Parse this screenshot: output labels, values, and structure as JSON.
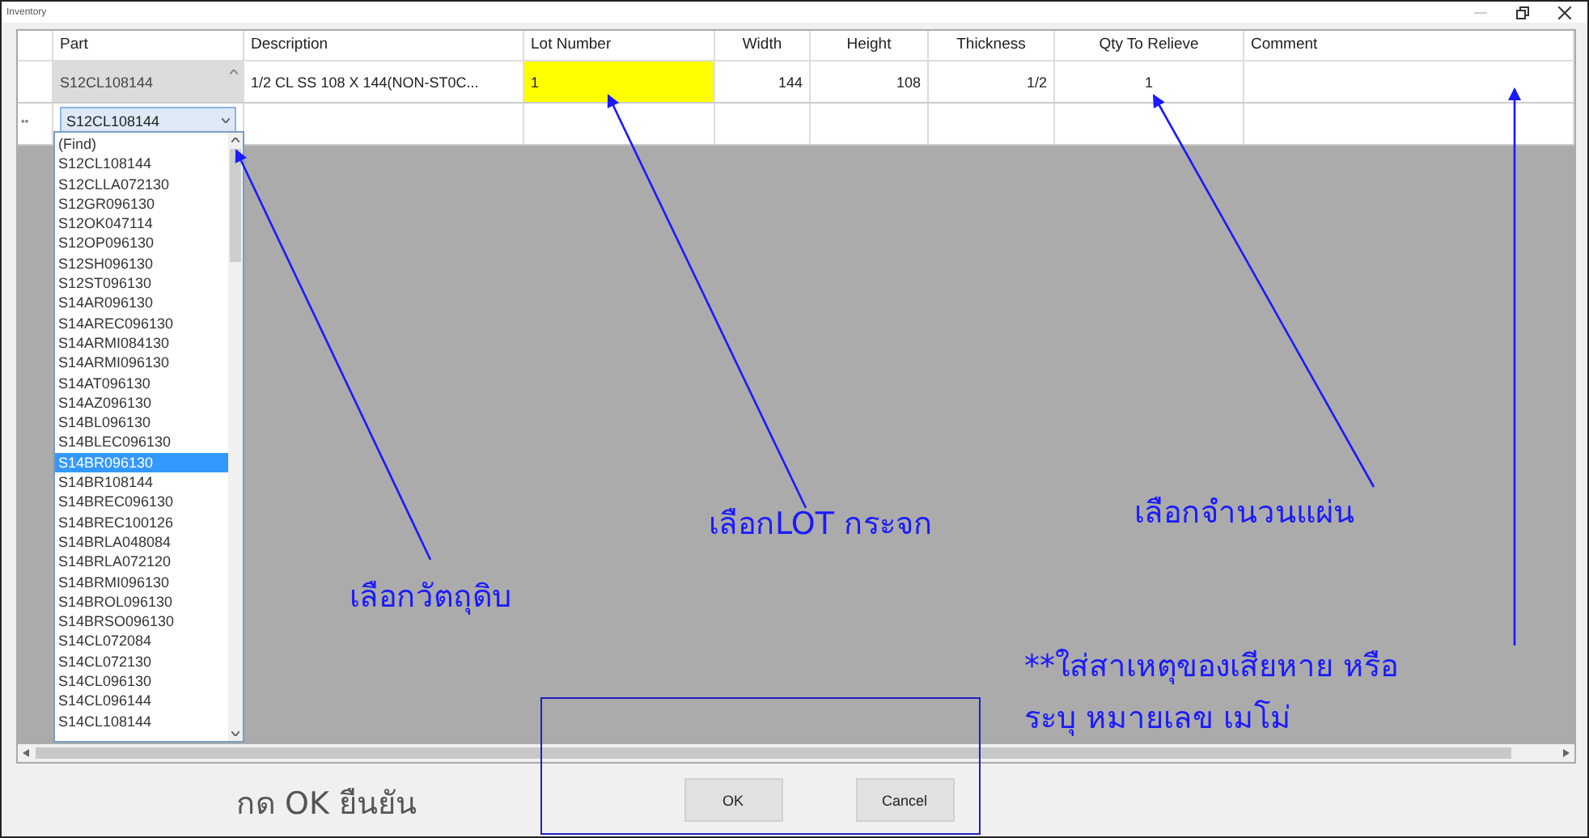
{
  "window": {
    "title": "Inventory"
  },
  "grid": {
    "columns": [
      "Part",
      "Description",
      "Lot Number",
      "Width",
      "Height",
      "Thickness",
      "Qty To Relieve",
      "Comment"
    ],
    "rows": [
      {
        "cells": [
          {
            "text": "S12CL108144",
            "highlighted": false
          },
          {
            "text": "1/2 CL SS 108 X 144(NON-ST0C...",
            "highlighted": false
          },
          {
            "text": "1",
            "highlighted": true
          },
          {
            "text": "144",
            "highlighted": false
          },
          {
            "text": "108",
            "highlighted": false
          },
          {
            "text": "1/2",
            "highlighted": false
          },
          {
            "text": "1",
            "highlighted": false
          }
        ]
      }
    ],
    "new_row": {
      "marker": "**",
      "part": "S12CL108144"
    }
  },
  "dropdown": {
    "items": [
      {
        "label": "(Find)",
        "selected": false
      },
      {
        "label": "S12CL108144",
        "selected": false
      },
      {
        "label": "S12CLLA072130",
        "selected": false
      },
      {
        "label": "S12GR096130",
        "selected": false
      },
      {
        "label": "S12OK047114",
        "selected": false
      },
      {
        "label": "S12OP096130",
        "selected": false
      },
      {
        "label": "S12SH096130",
        "selected": false
      },
      {
        "label": "S12ST096130",
        "selected": false
      },
      {
        "label": "S14AR096130",
        "selected": false
      },
      {
        "label": "S14AREC096130",
        "selected": false
      },
      {
        "label": "S14ARMI084130",
        "selected": false
      },
      {
        "label": "S14ARMI096130",
        "selected": false
      },
      {
        "label": "S14AT096130",
        "selected": false
      },
      {
        "label": "S14AZ096130",
        "selected": false
      },
      {
        "label": "S14BL096130",
        "selected": false
      },
      {
        "label": "S14BLEC096130",
        "selected": false
      },
      {
        "label": "S14BR096130",
        "selected": true
      },
      {
        "label": "S14BR108144",
        "selected": false
      },
      {
        "label": "S14BREC096130",
        "selected": false
      },
      {
        "label": "S14BREC100126",
        "selected": false
      },
      {
        "label": "S14BRLA048084",
        "selected": false
      },
      {
        "label": "S14BRLA072120",
        "selected": false
      },
      {
        "label": "S14BRMI096130",
        "selected": false
      },
      {
        "label": "S14BROL096130",
        "selected": false
      },
      {
        "label": "S14BRSO096130",
        "selected": false
      },
      {
        "label": "S14CL072084",
        "selected": false
      },
      {
        "label": "S14CL072130",
        "selected": false
      },
      {
        "label": "S14CL096130",
        "selected": false
      },
      {
        "label": "S14CL096144",
        "selected": false
      },
      {
        "label": "S14CL108144",
        "selected": false
      }
    ]
  },
  "buttons": [
    "OK",
    "Cancel"
  ],
  "annotations": [
    "เลือกวัตถุดิบ",
    "เลือกLOT กระจก",
    "เลือกจำนวนแผ่น",
    "**ใส่สาเหตุของเสียหาย หรือ",
    "ระบุ หมายเลข เมโม่",
    "กด OK ยืนยัน"
  ]
}
